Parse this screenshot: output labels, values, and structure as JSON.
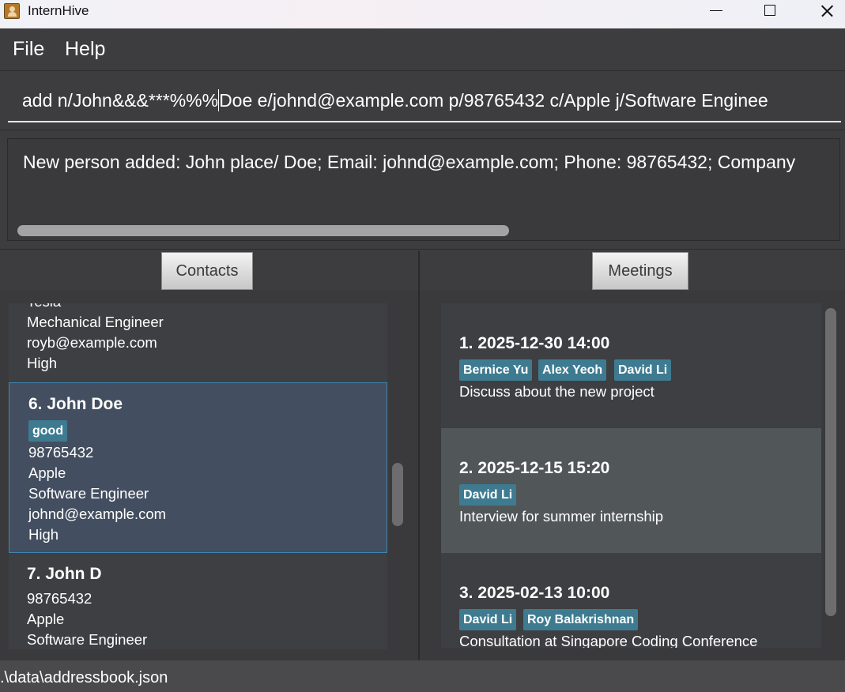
{
  "window": {
    "title": "InternHive"
  },
  "menu": {
    "file": "File",
    "help": "Help"
  },
  "command_box": {
    "before_caret": "add n/John&&&***%%%",
    "after_caret": "Doe e/johnd@example.com p/98765432 c/Apple j/Software Enginee"
  },
  "result_display": {
    "text": "New person added: John place/ Doe; Email: johnd@example.com; Phone: 98765432; Company"
  },
  "tabs": {
    "contacts": "Contacts",
    "meetings": "Meetings"
  },
  "contacts": {
    "partial_top": {
      "company": "Tesla",
      "job": "Mechanical Engineer",
      "email": "royb@example.com",
      "priority": "High"
    },
    "selected": {
      "title": "6. John Doe",
      "tag": "good",
      "phone": "98765432",
      "company": "Apple",
      "job": "Software Engineer",
      "email": "johnd@example.com",
      "priority": "High"
    },
    "next": {
      "title": "7. John D",
      "phone": "98765432",
      "company": "Apple",
      "job": "Software Engineer"
    }
  },
  "meetings": [
    {
      "title": "1. 2025-12-30 14:00",
      "tags": [
        "Bernice Yu",
        "Alex Yeoh",
        "David Li"
      ],
      "description": "Discuss about the new project"
    },
    {
      "title": "2. 2025-12-15 15:20",
      "tags": [
        "David Li"
      ],
      "description": "Interview for summer internship"
    },
    {
      "title": "3. 2025-02-13 10:00",
      "tags": [
        "David Li",
        "Roy Balakrishnan"
      ],
      "description": "Consultation at Singapore Coding Conference"
    }
  ],
  "status_bar": {
    "path": ".\\data\\addressbook.json"
  },
  "colors": {
    "background": "#3d3d3f",
    "tag": "#3e7b91",
    "selected_card": "#434f60",
    "highlight_meeting": "#515658"
  }
}
